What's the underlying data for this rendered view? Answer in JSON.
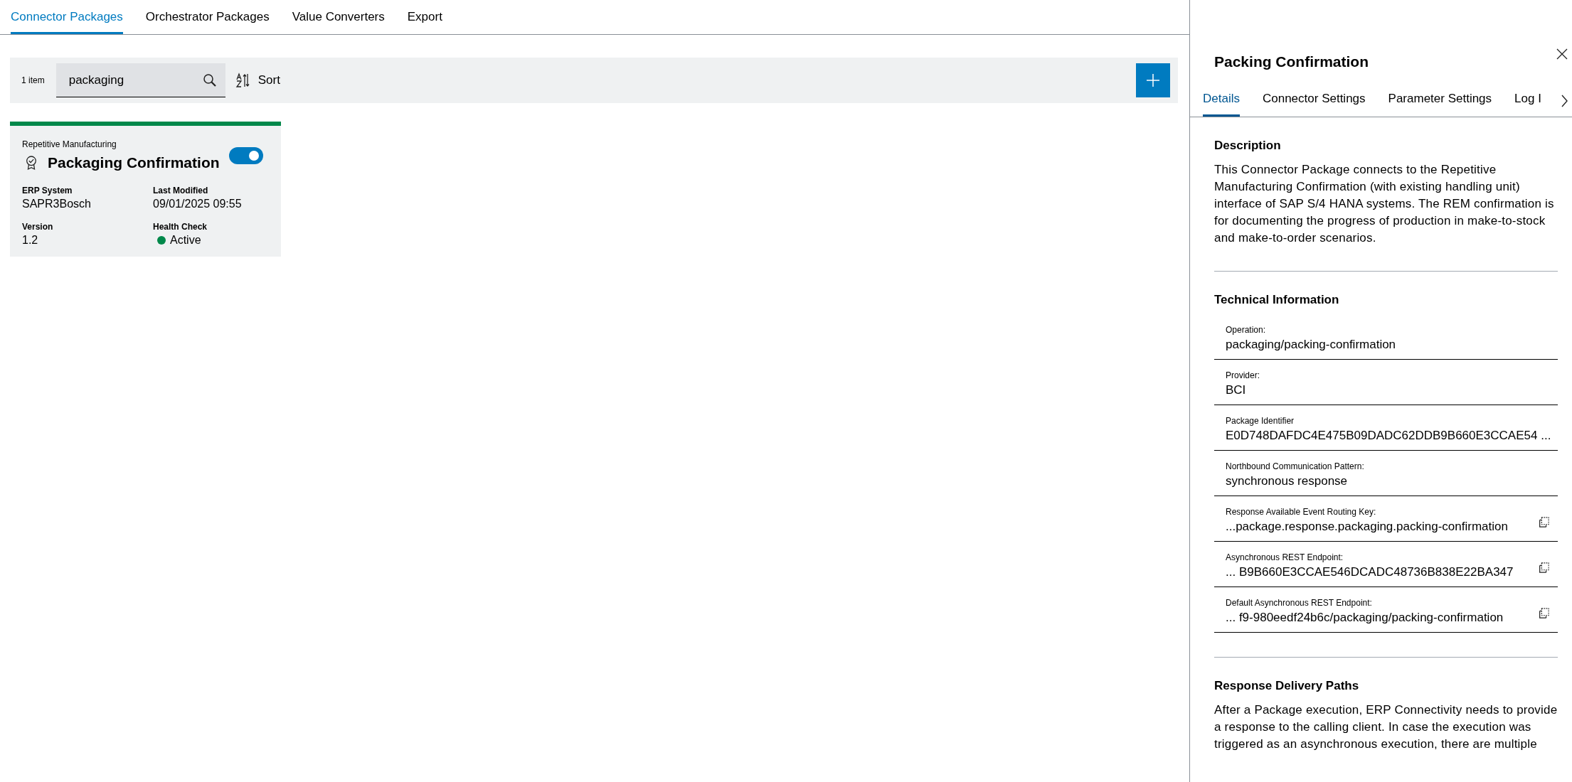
{
  "tabs": [
    {
      "label": "Connector Packages",
      "selected": true
    },
    {
      "label": "Orchestrator Packages",
      "selected": false
    },
    {
      "label": "Value Converters",
      "selected": false
    },
    {
      "label": "Export",
      "selected": false
    }
  ],
  "toolbar": {
    "count": "1 item",
    "search": {
      "value": "packaging"
    },
    "sort": "Sort"
  },
  "cards": [
    {
      "category": "Repetitive Manufacturing",
      "title": "Packaging Confirmation",
      "enabled": true,
      "color": "#00884a",
      "fields": [
        {
          "label": "ERP System",
          "value": "SAPR3Bosch"
        },
        {
          "label": "Last Modified",
          "value": "09/01/2025 09:55"
        },
        {
          "label": "Version",
          "value": "1.2"
        },
        {
          "label": "Health Check",
          "value": "Active",
          "kind": "status",
          "color": "#00884a"
        }
      ]
    }
  ],
  "details": {
    "title": "Packing Confirmation",
    "tabs": [
      {
        "label": "Details",
        "selected": true
      },
      {
        "label": "Connector Settings",
        "selected": false
      },
      {
        "label": "Parameter Settings",
        "selected": false
      },
      {
        "label": "Log I",
        "selected": false
      }
    ],
    "sections": [
      {
        "heading": "Description",
        "text": "This Connector Package connects to the Repetitive Manufacturing Confirmation (with existing handling unit) interface of SAP S/4 HANA systems. The REM confirmation is for documenting the progress of production in make-to-stock and make-to-order scenarios."
      },
      {
        "heading": "Technical Information",
        "fields": [
          {
            "label": "Operation:",
            "value": "packaging/packing-confirmation",
            "copyable": false
          },
          {
            "label": "Provider:",
            "value": "BCI",
            "copyable": false
          },
          {
            "label": "Package Identifier",
            "value": "E0D748DAFDC4E475B09DADC62DDB9B660E3CCAE54  ...",
            "copyable": false
          },
          {
            "label": "Northbound Communication Pattern:",
            "value": "synchronous response",
            "copyable": false
          },
          {
            "label": "Response Available Event Routing Key:",
            "value": "...package.response.packaging.packing-confirmation",
            "copyable": true
          },
          {
            "label": "Asynchronous REST Endpoint:",
            "value": "...  B9B660E3CCAE546DCADC48736B838E22BA347",
            "copyable": true
          },
          {
            "label": "Default Asynchronous REST Endpoint:",
            "value": "... f9-980eedf24b6c/packaging/packing-confirmation",
            "copyable": true
          }
        ]
      },
      {
        "heading": "Response Delivery Paths",
        "text": "After a Package execution, ERP Connectivity needs to provide a response to the calling client. In case the execution was triggered as an asynchronous execution, there are multiple"
      }
    ]
  }
}
